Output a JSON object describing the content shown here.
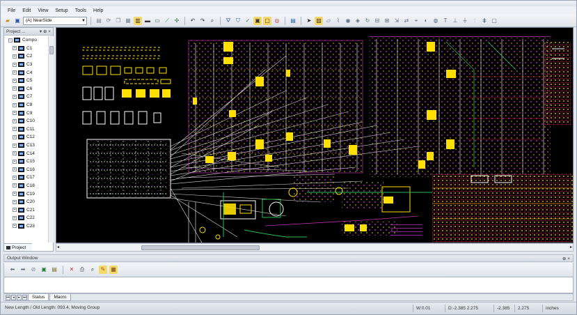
{
  "menu": [
    "File",
    "Edit",
    "View",
    "Setup",
    "Tools",
    "Help"
  ],
  "toolbar": {
    "layer_select": "(A) NearSide"
  },
  "project_panel": {
    "title": "Project ...",
    "pin": "▾ ⊕ ×",
    "root_label": "Compo",
    "items": [
      "C1",
      "C2",
      "C3",
      "C4",
      "C5",
      "C6",
      "C7",
      "C8",
      "C9",
      "C10",
      "C11",
      "C12",
      "C13",
      "C14",
      "C15",
      "C16",
      "C17",
      "C18",
      "C19",
      "C20",
      "C21",
      "C22",
      "C23"
    ],
    "tab_label": "Project"
  },
  "output_window": {
    "title": "Output Window",
    "controls": "⊕ ×",
    "tabs": [
      "Status",
      "Macro"
    ],
    "active_tab": "Status"
  },
  "status": {
    "message": "New Length / Old Length: 093.4, Moving Group",
    "w": "W:0.01",
    "d": "D:-2.385 2.275",
    "x": "-2.385",
    "y": "2.275",
    "units": "inches"
  },
  "colors": {
    "trace_yellow": "#ffe000",
    "trace_red": "#e0203a",
    "trace_magenta": "#d040c0",
    "trace_green": "#28c050",
    "trace_white": "#ffffff"
  }
}
